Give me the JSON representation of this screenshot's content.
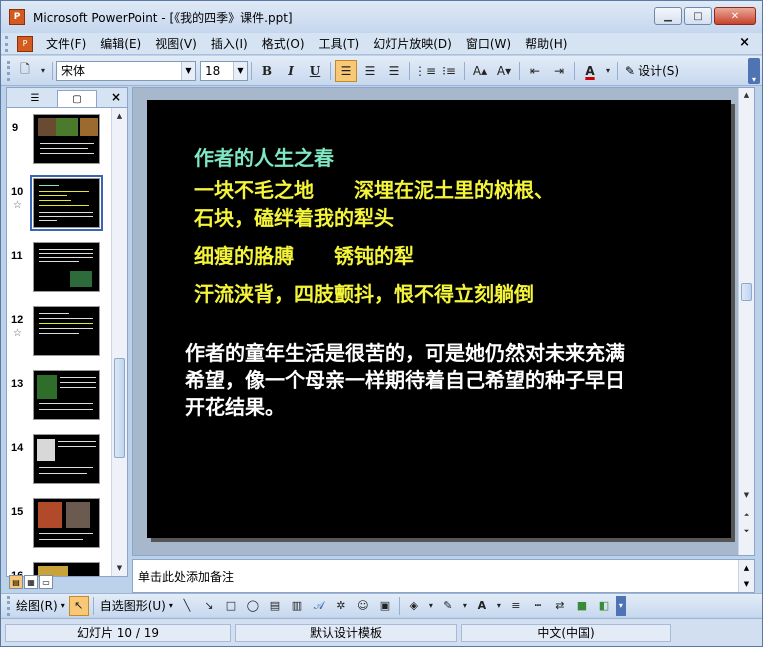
{
  "window": {
    "title": "Microsoft PowerPoint - [《我的四季》课件.ppt]",
    "app_icon": "P",
    "buttons": [
      "minimize-icon",
      "maximize-icon",
      "close-icon"
    ]
  },
  "menu": {
    "items": [
      "文件(F)",
      "编辑(E)",
      "视图(V)",
      "插入(I)",
      "格式(O)",
      "工具(T)",
      "幻灯片放映(D)",
      "窗口(W)",
      "帮助(H)"
    ],
    "close": "×"
  },
  "toolbar": {
    "font_name": "宋体",
    "font_size": "18",
    "bold": "B",
    "italic": "I",
    "underline": "U",
    "design_label": "设计(S)"
  },
  "left_panel": {
    "tabs": [
      "outline-tab-icon",
      "slides-tab-icon"
    ],
    "close": "×",
    "thumbnails": [
      {
        "number": "9",
        "has_star": false
      },
      {
        "number": "10",
        "has_star": true,
        "selected": true
      },
      {
        "number": "11",
        "has_star": false
      },
      {
        "number": "12",
        "has_star": true
      },
      {
        "number": "13",
        "has_star": false
      },
      {
        "number": "14",
        "has_star": false
      },
      {
        "number": "15",
        "has_star": false
      },
      {
        "number": "16",
        "has_star": false
      }
    ]
  },
  "slide": {
    "title": "作者的人生之春",
    "lines_yellow": [
      "一块不毛之地　　深埋在泥土里的树根、",
      "石块，磕绊着我的犁头",
      "细瘦的胳膊　　锈钝的犁",
      "汗流浃背，四肢颤抖，恨不得立刻躺倒"
    ],
    "paragraph": "作者的童年生活是很苦的，可是她仍然对未来充满\n希望，像一个母亲一样期待着自己希望的种子早日\n开花结果。",
    "colors": {
      "title": "#7fe8c2",
      "yellow": "#f4f43a",
      "white": "#ffffff",
      "background": "#000000"
    }
  },
  "notes": {
    "placeholder": "单击此处添加备注"
  },
  "draw_toolbar": {
    "draw_label": "绘图(R)",
    "autoshapes_label": "自选图形(U)"
  },
  "status": {
    "slide_info": "幻灯片 10 / 19",
    "template": "默认设计模板",
    "language": "中文(中国)"
  }
}
